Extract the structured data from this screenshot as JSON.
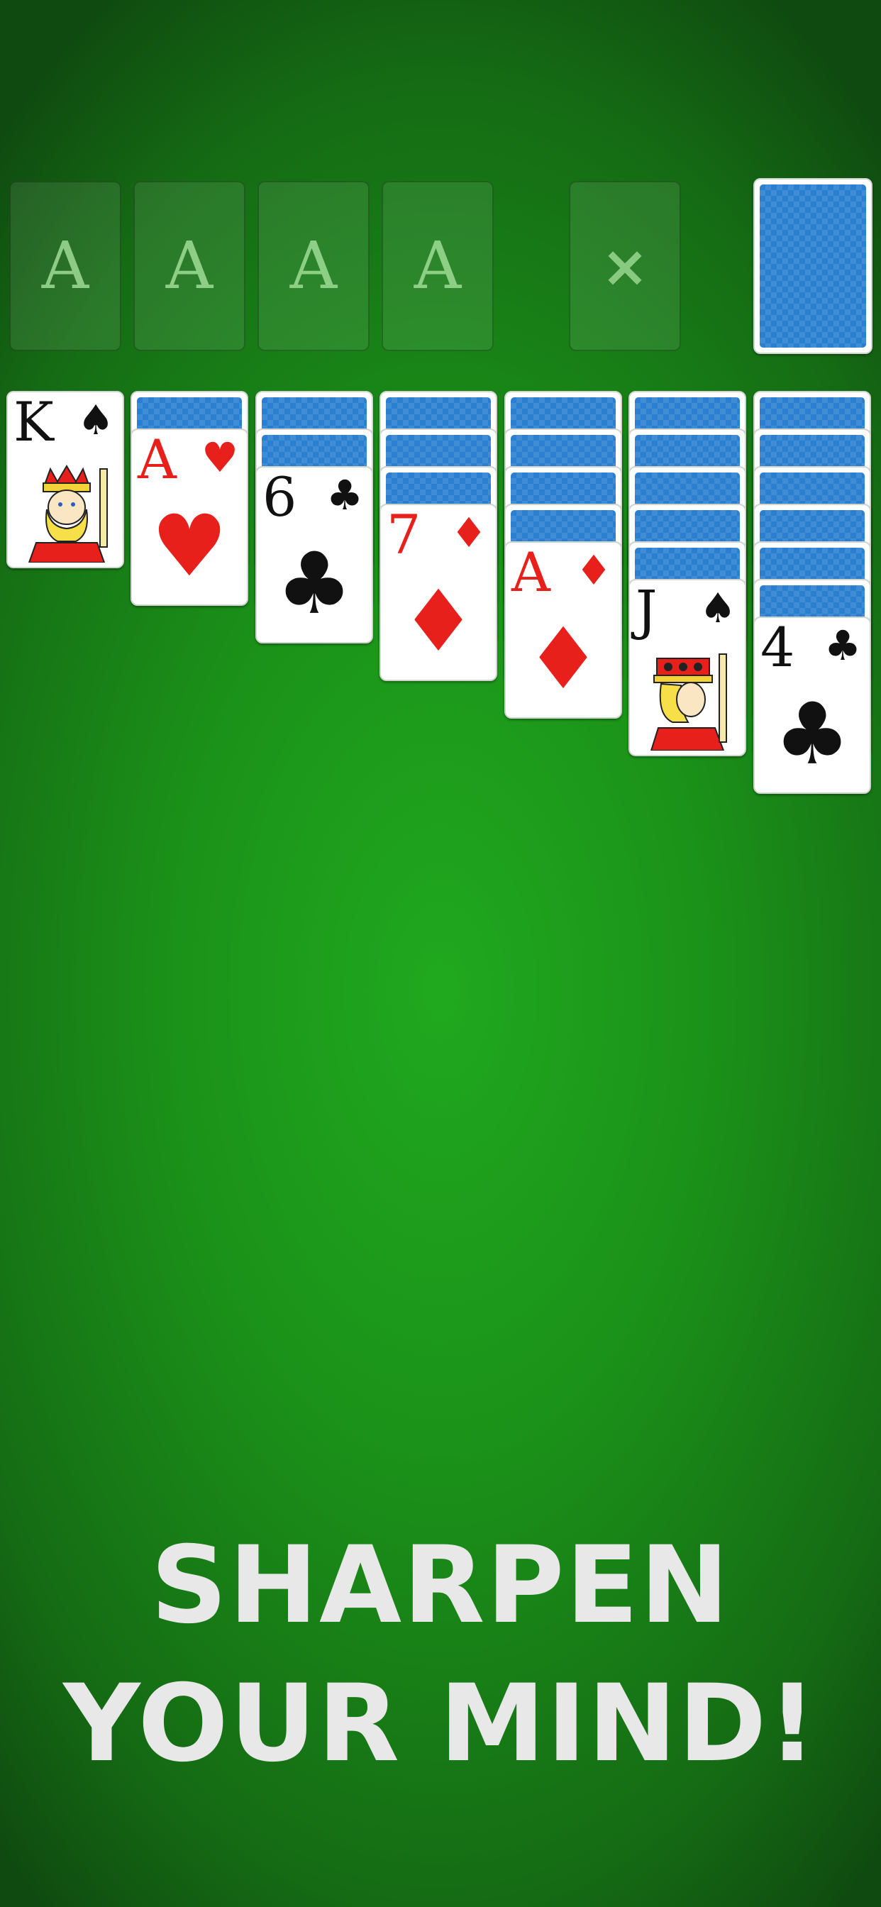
{
  "foundations": [
    {
      "label": "A"
    },
    {
      "label": "A"
    },
    {
      "label": "A"
    },
    {
      "label": "A"
    }
  ],
  "waste_slot": {
    "icon": "close-icon",
    "glyph": "×"
  },
  "stock": {
    "state": "face-down"
  },
  "tableau": [
    {
      "face_down": 0,
      "card": {
        "rank": "K",
        "suit": "♠",
        "color": "black",
        "face": "king"
      }
    },
    {
      "face_down": 1,
      "card": {
        "rank": "A",
        "suit": "♥",
        "color": "red"
      }
    },
    {
      "face_down": 2,
      "card": {
        "rank": "6",
        "suit": "♣",
        "color": "black"
      }
    },
    {
      "face_down": 3,
      "card": {
        "rank": "7",
        "suit": "♦",
        "color": "red"
      }
    },
    {
      "face_down": 4,
      "card": {
        "rank": "A",
        "suit": "♦",
        "color": "red"
      }
    },
    {
      "face_down": 5,
      "card": {
        "rank": "J",
        "suit": "♠",
        "color": "black",
        "face": "jack"
      }
    },
    {
      "face_down": 6,
      "card": {
        "rank": "4",
        "suit": "♣",
        "color": "black"
      }
    }
  ],
  "slogan": {
    "line1": "SHARPEN",
    "line2": "YOUR MIND!"
  },
  "colors": {
    "felt": "#1f9f1e",
    "card_back": "#2a7fd0",
    "red_suit": "#e8201c",
    "black_suit": "#111111",
    "slogan": "#e8e8e8"
  }
}
